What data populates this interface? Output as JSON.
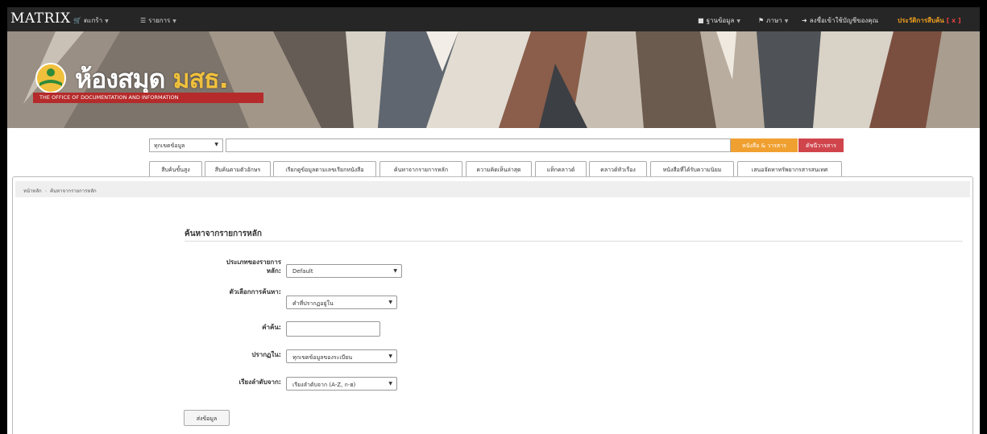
{
  "navbar": {
    "brand": "MATRIX",
    "cart": "ตะกร้า",
    "list": "รายการ",
    "databases": "ฐานข้อมูล",
    "language": "ภาษา",
    "login": "ลงชื่อเข้าใช้บัญชีของคุณ",
    "history": "ประวัติการสืบค้น",
    "history_close": "[ x ]"
  },
  "banner": {
    "logo_text": "ห้องสมุด",
    "logo_acronym": "มสธ.",
    "logo_sub": "THE OFFICE OF DOCUMENTATION AND INFORMATION"
  },
  "search": {
    "scope": "ทุกเขตข้อมูล",
    "books_button": "หนังสือ & วารสาร",
    "journals_button": "ดัชนีวารสาร"
  },
  "tabs": [
    "สืบค้นขั้นสูง",
    "สืบค้นตามตัวอักษร",
    "เรียกดูข้อมูลตามเลขเรียกหนังสือ",
    "ค้นหาจากรายการหลัก",
    "ความคิดเห็นล่าสุด",
    "แท็กคลาวด์",
    "คลาวด์หัวเรื่อง",
    "หนังสือที่ได้รับความนิยม",
    "เสนอจัดหาทรัพยากรสารสนเทศ"
  ],
  "breadcrumb": {
    "home": "หน้าหลัก",
    "current": "ค้นหาจากรายการหลัก"
  },
  "form": {
    "title": "ค้นหาจากรายการหลัก",
    "type_label_1": "ประเภทของรายการ",
    "type_label_2": "หลัก:",
    "type_value": "Default",
    "option_label": "ตัวเลือกการค้นหา:",
    "option_value": "คำที่ปรากฏอยู่ใน",
    "keyword_label": "คำค้น:",
    "appear_label": "ปรากฏใน:",
    "appear_value": "ทุกเขตข้อมูลของระเบียน",
    "sort_label": "เรียงลำดับจาก:",
    "sort_value": "เรียงลำดับจาก (A-Z, ก-ฮ)",
    "submit": "ส่งข้อมูล"
  },
  "colors": {
    "navbar": "#262626",
    "books_button": "#f0a030",
    "journals_button": "#d0454c",
    "logo_sub_bg": "#b52a2a",
    "history": "#f0a020"
  },
  "icons": [
    "cart-icon",
    "list-icon",
    "database-icon",
    "flag-icon",
    "login-icon",
    "book-logo-icon"
  ]
}
